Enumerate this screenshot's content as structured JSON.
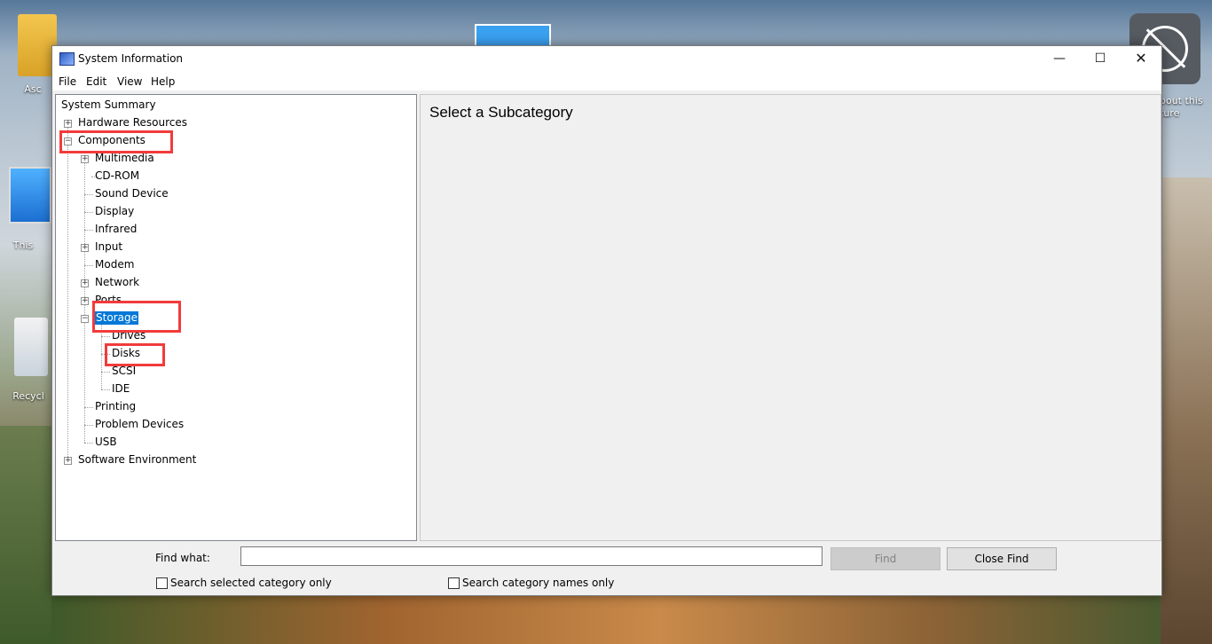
{
  "desktop": {
    "icons": [
      {
        "label": "Asc"
      },
      {
        "label": "This"
      },
      {
        "label": "Recycl"
      },
      {
        "label": "bout this\nture"
      }
    ]
  },
  "window": {
    "title": "System Information",
    "controls": {
      "minimize": "—",
      "maximize": "☐",
      "close": "✕"
    }
  },
  "menu": [
    "File",
    "Edit",
    "View",
    "Help"
  ],
  "tree": {
    "root": "System Summary",
    "hardware": "Hardware Resources",
    "components": "Components",
    "multimedia": "Multimedia",
    "cdrom": "CD-ROM",
    "sound": "Sound Device",
    "display": "Display",
    "infrared": "Infrared",
    "input": "Input",
    "modem": "Modem",
    "network": "Network",
    "ports": "Ports",
    "storage": "Storage",
    "drives": "Drives",
    "disks": "Disks",
    "scsi": "SCSI",
    "ide": "IDE",
    "printing": "Printing",
    "problem": "Problem Devices",
    "usb": "USB",
    "software": "Software Environment"
  },
  "detail": {
    "heading": "Select a Subcategory"
  },
  "find": {
    "label": "Find what:",
    "value": "",
    "find_button": "Find",
    "close_find_button": "Close Find",
    "search_selected": "Search selected category only",
    "search_names": "Search category names only"
  },
  "colors": {
    "highlight": "#f23b3b",
    "selection": "#0078d7"
  }
}
